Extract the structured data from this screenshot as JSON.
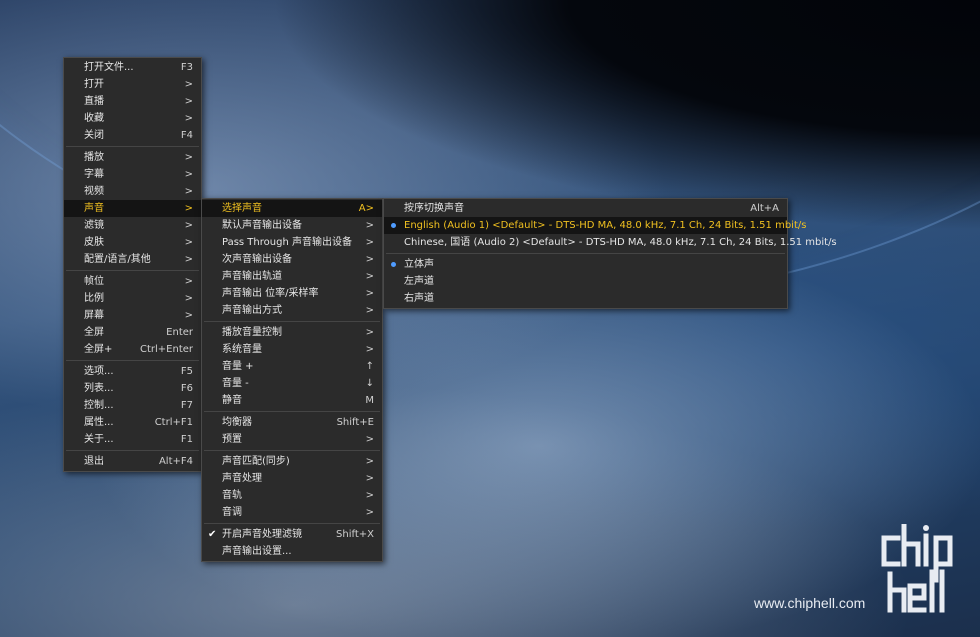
{
  "main_menu": {
    "items": [
      {
        "label": "打开文件...",
        "shortcut": "F3"
      },
      {
        "label": "打开",
        "shortcut": ">"
      },
      {
        "label": "直播",
        "shortcut": ">"
      },
      {
        "label": "收藏",
        "shortcut": ">"
      },
      {
        "label": "关闭",
        "shortcut": "F4"
      },
      {
        "label": "播放",
        "shortcut": ">"
      },
      {
        "label": "字幕",
        "shortcut": ">"
      },
      {
        "label": "视频",
        "shortcut": ">"
      },
      {
        "label": "声音",
        "shortcut": ">"
      },
      {
        "label": "滤镜",
        "shortcut": ">"
      },
      {
        "label": "皮肤",
        "shortcut": ">"
      },
      {
        "label": "配置/语言/其他",
        "shortcut": ">"
      },
      {
        "label": "帧位",
        "shortcut": ">"
      },
      {
        "label": "比例",
        "shortcut": ">"
      },
      {
        "label": "屏幕",
        "shortcut": ">"
      },
      {
        "label": "全屏",
        "shortcut": "Enter"
      },
      {
        "label": "全屏+",
        "shortcut": "Ctrl+Enter"
      },
      {
        "label": "选项...",
        "shortcut": "F5"
      },
      {
        "label": "列表...",
        "shortcut": "F6"
      },
      {
        "label": "控制...",
        "shortcut": "F7"
      },
      {
        "label": "属性...",
        "shortcut": "Ctrl+F1"
      },
      {
        "label": "关于...",
        "shortcut": "F1"
      },
      {
        "label": "退出",
        "shortcut": "Alt+F4"
      }
    ]
  },
  "audio_menu": {
    "items": [
      {
        "label": "选择声音",
        "shortcut": "A>"
      },
      {
        "label": "默认声音输出设备",
        "shortcut": ">"
      },
      {
        "label": "Pass Through 声音输出设备",
        "shortcut": ">"
      },
      {
        "label": "次声音输出设备",
        "shortcut": ">"
      },
      {
        "label": "声音输出轨道",
        "shortcut": ">"
      },
      {
        "label": "声音输出 位率/采样率",
        "shortcut": ">"
      },
      {
        "label": "声音输出方式",
        "shortcut": ">"
      },
      {
        "label": "播放音量控制",
        "shortcut": ">"
      },
      {
        "label": "系统音量",
        "shortcut": ">"
      },
      {
        "label": "音量 +",
        "shortcut": "↑"
      },
      {
        "label": "音量 -",
        "shortcut": "↓"
      },
      {
        "label": "静音",
        "shortcut": "M"
      },
      {
        "label": "均衡器",
        "shortcut": "Shift+E"
      },
      {
        "label": "预置",
        "shortcut": ">"
      },
      {
        "label": "声音匹配(同步)",
        "shortcut": ">"
      },
      {
        "label": "声音处理",
        "shortcut": ">"
      },
      {
        "label": "音轨",
        "shortcut": ">"
      },
      {
        "label": "音调",
        "shortcut": ">"
      },
      {
        "label": "开启声音处理滤镜",
        "shortcut": "Shift+X"
      },
      {
        "label": "声音输出设置...",
        "shortcut": ""
      }
    ],
    "check_mark": "✔"
  },
  "track_menu": {
    "items": [
      {
        "label": "按序切换声音",
        "shortcut": "Alt+A"
      },
      {
        "label": "English (Audio 1) <Default> - DTS-HD MA, 48.0 kHz, 7.1 Ch, 24 Bits, 1.51 mbit/s",
        "shortcut": ""
      },
      {
        "label": "Chinese, 国语 (Audio 2) <Default> - DTS-HD MA, 48.0 kHz, 7.1 Ch, 24 Bits, 1.51 mbit/s",
        "shortcut": ""
      },
      {
        "label": "立体声",
        "shortcut": ""
      },
      {
        "label": "左声道",
        "shortcut": ""
      },
      {
        "label": "右声道",
        "shortcut": ""
      }
    ]
  },
  "watermark": {
    "logo_text": "chip hell",
    "url": "www.chiphell.com"
  },
  "colors": {
    "menu_bg": "#2b2b2b",
    "highlight_bg": "#141414",
    "highlight_text": "#f0c020",
    "radio": "#4f9cff"
  }
}
